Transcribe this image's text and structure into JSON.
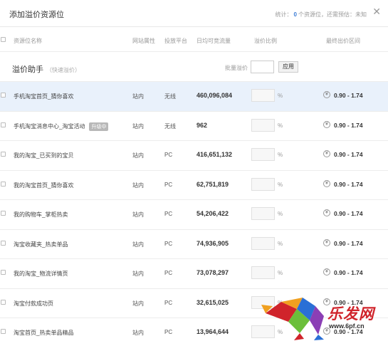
{
  "header": {
    "title": "添加溢价资源位",
    "summary_prefix": "统计：",
    "summary_count": "0",
    "summary_suffix": "个资源位，还需预估：未知",
    "close_glyph": "✕"
  },
  "columns": {
    "name": "资源位名称",
    "attr": "网站属性",
    "platform": "投放平台",
    "flow": "日均可竞流量",
    "rate": "溢价比例",
    "range": "最终出价区间"
  },
  "helper": {
    "title": "溢价助手",
    "subtitle": "（快速溢价）",
    "batch_label": "批量溢价",
    "batch_value": "",
    "apply_label": "应用"
  },
  "rows": [
    {
      "name": "手机淘宝首页_猜你喜欢",
      "badge": "",
      "attr": "站内",
      "platform": "无线",
      "flow": "460,096,084",
      "rate": "",
      "pct": "%",
      "yen": "¥",
      "range": "0.90 - 1.74"
    },
    {
      "name": "手机淘宝消息中心_淘宝活动",
      "badge": "升级中",
      "attr": "站内",
      "platform": "无线",
      "flow": "962",
      "rate": "",
      "pct": "%",
      "yen": "¥",
      "range": "0.90 - 1.74"
    },
    {
      "name": "我的淘宝_已买到的宝贝",
      "badge": "",
      "attr": "站内",
      "platform": "PC",
      "flow": "416,651,132",
      "rate": "",
      "pct": "%",
      "yen": "¥",
      "range": "0.90 - 1.74"
    },
    {
      "name": "我的淘宝首页_猜你喜欢",
      "badge": "",
      "attr": "站内",
      "platform": "PC",
      "flow": "62,751,819",
      "rate": "",
      "pct": "%",
      "yen": "¥",
      "range": "0.90 - 1.74"
    },
    {
      "name": "我的购物车_掌柜热卖",
      "badge": "",
      "attr": "站内",
      "platform": "PC",
      "flow": "54,206,422",
      "rate": "",
      "pct": "%",
      "yen": "¥",
      "range": "0.90 - 1.74"
    },
    {
      "name": "淘宝收藏夹_热卖单品",
      "badge": "",
      "attr": "站内",
      "platform": "PC",
      "flow": "74,936,905",
      "rate": "",
      "pct": "%",
      "yen": "¥",
      "range": "0.90 - 1.74"
    },
    {
      "name": "我的淘宝_物流详情页",
      "badge": "",
      "attr": "站内",
      "platform": "PC",
      "flow": "73,078,297",
      "rate": "",
      "pct": "%",
      "yen": "¥",
      "range": "0.90 - 1.74"
    },
    {
      "name": "淘宝付款成功页",
      "badge": "",
      "attr": "站内",
      "platform": "PC",
      "flow": "32,615,025",
      "rate": "",
      "pct": "%",
      "yen": "¥",
      "range": "0.90 - 1.74"
    },
    {
      "name": "淘宝首页_热卖单品精品",
      "badge": "",
      "attr": "站内",
      "platform": "PC",
      "flow": "13,964,644",
      "rate": "",
      "pct": "%",
      "yen": "¥",
      "range": "0.90 - 1.74"
    }
  ],
  "watermark": {
    "logo_text": "乐发网",
    "url": "www.6pf.cn",
    "colors": [
      "#d0242b",
      "#f0a020",
      "#2a6fd6",
      "#6bbf3a",
      "#8b3fb5"
    ]
  },
  "colors": {
    "accent": "#3a7bd5",
    "highlight_row": "#e9f1fb",
    "badge": "#b8b8b8"
  }
}
